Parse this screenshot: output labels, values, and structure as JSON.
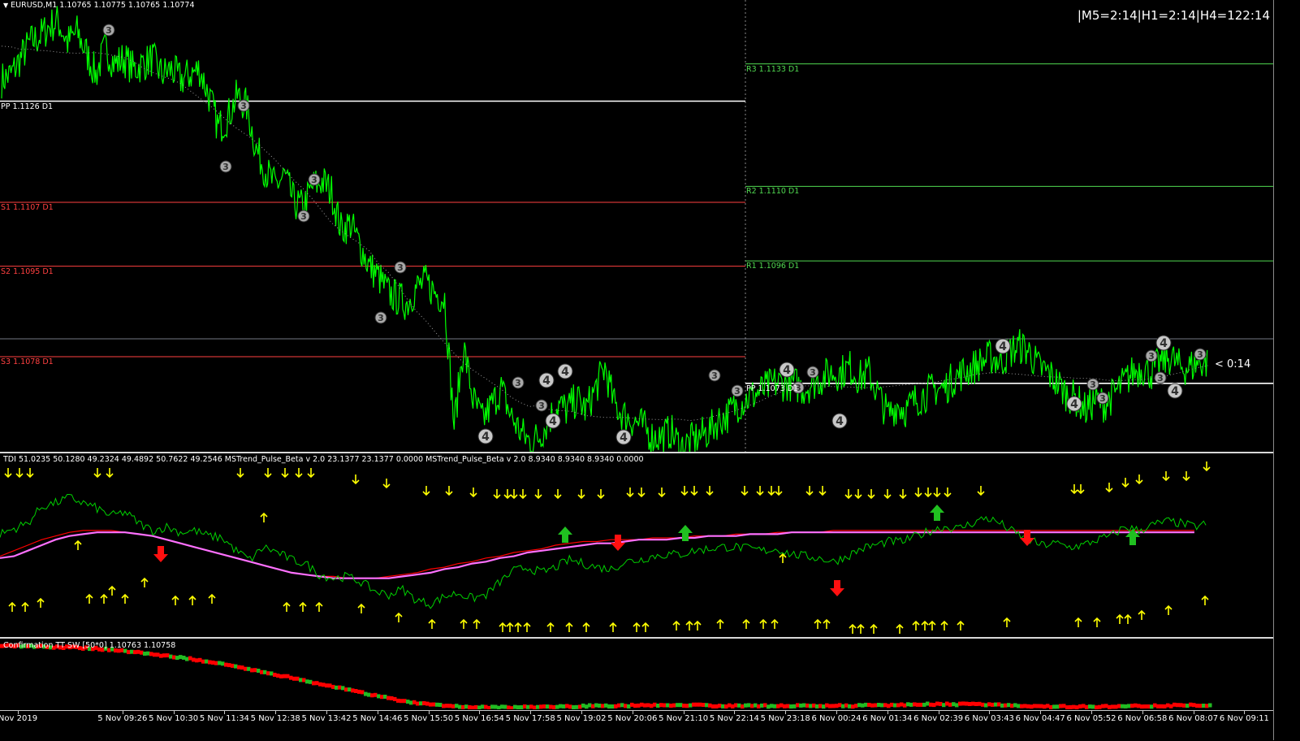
{
  "window": {
    "symbol_title": "EURUSD,M1  1.10765 1.10775 1.10765 1.10774",
    "timer_label": "|M5=2:14|H1=2:14|H4=122:14",
    "countdown_label": "< 0:14"
  },
  "colors": {
    "background": "#000000",
    "price_line": "#00ff00",
    "pivot_line": "#ffffff",
    "support_line": "#ff4040",
    "resistance_line": "#50d850",
    "ma_dotted": "#9a9a9a",
    "tdi_green": "#00d000",
    "tdi_red": "#ff0000",
    "tdi_violet": "#ff70ff",
    "arrow_yellow": "#ffff00",
    "arrow_green_big": "#20c020",
    "arrow_red_big": "#ff1010",
    "conf_red": "#ff0000",
    "conf_green": "#22bb22"
  },
  "pivot_levels_left": [
    {
      "label": "PP 1.1126 D1",
      "price": 1.1126,
      "color": "#ffffff"
    },
    {
      "label": "S1 1.1107 D1",
      "price": 1.1107,
      "color": "#ff4040"
    },
    {
      "label": "S2 1.1095 D1",
      "price": 1.1095,
      "color": "#ff4040"
    },
    {
      "label": "S3 1.1078 D1",
      "price": 1.1078,
      "color": "#ff4040"
    }
  ],
  "pivot_levels_right": [
    {
      "label": "R3 1.1133 D1",
      "price": 1.1133,
      "color": "#50d850"
    },
    {
      "label": "R2 1.1110 D1",
      "price": 1.111,
      "color": "#50d850"
    },
    {
      "label": "R1 1.1096 D1",
      "price": 1.1096,
      "color": "#50d850"
    },
    {
      "label": "PP 1.1073 D1",
      "price": 1.1073,
      "color": "#ffffff"
    }
  ],
  "current_price_line": {
    "price": 1.10774
  },
  "tdi_title": "TDI 51.0235 50.1280 49.2324 49.4892 50.7622 49.2546  MSTrend_Pulse_Beta v 2.0 23.1377 23.1377 0.0000  MSTrend_Pulse_Beta v 2.0 8.9340 8.9340 8.9340 0.0000",
  "confirmation_title": "Confirmation TT SW [50*0] 1.10763 1.10758",
  "time_labels": [
    "Nov 2019",
    "5 Nov 09:26",
    "5 Nov 10:30",
    "5 Nov 11:34",
    "5 Nov 12:38",
    "5 Nov 13:42",
    "5 Nov 14:46",
    "5 Nov 15:50",
    "5 Nov 16:54",
    "5 Nov 17:58",
    "5 Nov 19:02",
    "5 Nov 20:06",
    "5 Nov 21:10",
    "5 Nov 22:14",
    "5 Nov 23:18",
    "6 Nov 00:24",
    "6 Nov 01:34",
    "6 Nov 02:39",
    "6 Nov 03:43",
    "6 Nov 04:47",
    "6 Nov 05:52",
    "6 Nov 06:58",
    "6 Nov 08:07",
    "6 Nov 09:11"
  ],
  "chart_data": [
    {
      "type": "line",
      "ylim": [
        1.106,
        1.1145
      ],
      "series": [
        {
          "values": [
            1.113,
            1.1131,
            1.1134,
            1.1137,
            1.1138,
            1.114,
            1.1141,
            1.1137,
            1.1139,
            1.1135,
            1.1131,
            1.1136,
            1.1133,
            1.1134,
            1.1132,
            1.1133,
            1.1134,
            1.1131,
            1.1132,
            1.113,
            1.1131,
            1.1132,
            1.1127,
            1.1121,
            1.1123,
            1.1127,
            1.1125,
            1.1117,
            1.1113,
            1.111,
            1.1112,
            1.1107,
            1.1106,
            1.111,
            1.1111,
            1.1109,
            1.1102,
            1.1103,
            1.1099,
            1.1095,
            1.1093,
            1.109,
            1.1089,
            1.1088,
            1.1091,
            1.1092,
            1.109,
            1.1089,
            1.1065,
            1.108,
            1.107,
            1.1066,
            1.1069,
            1.1072,
            1.1067,
            1.1064,
            1.1062,
            1.1063,
            1.1066,
            1.1069,
            1.1068,
            1.107,
            1.1068,
            1.1072,
            1.1076,
            1.1069,
            1.1067,
            1.1066,
            1.1065,
            1.1063,
            1.1063,
            1.1064,
            1.1061,
            1.1062,
            1.1063,
            1.1064,
            1.1066,
            1.1067,
            1.1069,
            1.107,
            1.1071,
            1.1072,
            1.1073,
            1.1073,
            1.1073,
            1.1072,
            1.1073,
            1.1074,
            1.1075,
            1.1075,
            1.1076,
            1.1074,
            1.1075,
            1.1071,
            1.1067,
            1.1069,
            1.1068,
            1.107,
            1.1071,
            1.1072,
            1.1072,
            1.1074,
            1.1075,
            1.1076,
            1.1077,
            1.1078,
            1.1077,
            1.1079,
            1.108,
            1.1079,
            1.1076,
            1.1075,
            1.1073,
            1.1071,
            1.107,
            1.1068,
            1.107,
            1.1069,
            1.1071,
            1.1073,
            1.1075,
            1.1076,
            1.1075,
            1.1077,
            1.1078,
            1.1076,
            1.1076,
            1.1077,
            1.1077
          ]
        }
      ]
    },
    {
      "type": "line",
      "ylim": [
        0,
        100
      ],
      "series": [
        {
          "values": [
            56,
            59,
            62,
            71,
            73,
            76,
            73,
            70,
            66,
            68,
            62,
            58,
            60,
            57,
            58,
            55,
            54,
            47,
            42,
            49,
            46,
            42,
            40,
            34,
            32,
            33,
            30,
            25,
            23,
            26,
            20,
            18,
            22,
            24,
            21,
            23,
            30,
            36,
            38,
            35,
            38,
            42,
            40,
            38,
            37,
            41,
            42,
            44,
            45,
            45,
            47,
            48,
            49,
            49,
            48,
            47,
            48,
            45,
            44,
            43,
            41,
            44,
            48,
            50,
            52,
            52,
            55,
            58,
            60,
            59,
            62,
            65,
            62,
            57,
            53,
            50,
            51,
            49,
            50,
            53,
            55,
            60,
            58,
            61,
            63,
            62,
            60,
            62
          ]
        },
        {
          "values": [
            44,
            47,
            50,
            53,
            55,
            57,
            58,
            58,
            58,
            57,
            56,
            55,
            53,
            51,
            49,
            47,
            45,
            43,
            41,
            39,
            37,
            35,
            34,
            33,
            33,
            32,
            32,
            32,
            33,
            34,
            35,
            37,
            38,
            40,
            41,
            43,
            44,
            46,
            47,
            48,
            50,
            51,
            52,
            52,
            53,
            53,
            53,
            54,
            54,
            54,
            55,
            55,
            55,
            56,
            56,
            56,
            57,
            57,
            57,
            57,
            58,
            58,
            58,
            58,
            58,
            58,
            58,
            58,
            58,
            58,
            58,
            58,
            58,
            58,
            58,
            58,
            58,
            58,
            58,
            58,
            58,
            58,
            58,
            58,
            58,
            58,
            58,
            58
          ]
        },
        {
          "values": [
            43,
            44,
            47,
            50,
            53,
            55,
            56,
            57,
            57,
            57,
            56,
            55,
            53,
            51,
            49,
            47,
            45,
            43,
            41,
            39,
            37,
            35,
            34,
            33,
            32,
            32,
            32,
            32,
            32,
            33,
            34,
            35,
            37,
            38,
            40,
            41,
            43,
            44,
            46,
            47,
            48,
            49,
            50,
            51,
            51,
            52,
            53,
            53,
            53,
            54,
            54,
            55,
            55,
            55,
            56,
            56,
            56,
            57,
            57,
            57,
            57,
            57,
            57,
            57,
            57,
            57,
            57,
            57,
            57,
            57,
            57,
            57,
            57,
            57,
            57,
            57,
            57,
            57,
            57,
            57,
            57,
            57,
            57,
            57,
            57,
            57,
            57,
            57
          ]
        }
      ]
    },
    {
      "type": "line",
      "ylim": [
        1.1055,
        1.1145
      ],
      "series": [
        {
          "values": [
            1.114,
            1.1139,
            1.1138,
            1.1137,
            1.1135,
            1.1132,
            1.1128,
            1.1124,
            1.1119,
            1.1113,
            1.1107,
            1.11,
            1.1093,
            1.1086,
            1.1079,
            1.1072,
            1.1066,
            1.1063,
            1.1061,
            1.106,
            1.106,
            1.1061,
            1.1061,
            1.1062,
            1.1062,
            1.1063,
            1.1063,
            1.1063,
            1.1062,
            1.1062,
            1.1062,
            1.1062,
            1.1062,
            1.1062,
            1.1063,
            1.1063,
            1.1064,
            1.1064,
            1.1064,
            1.1063,
            1.1062,
            1.1061,
            1.1061,
            1.1061,
            1.1062,
            1.1062,
            1.1063,
            1.1063
          ]
        }
      ]
    }
  ]
}
